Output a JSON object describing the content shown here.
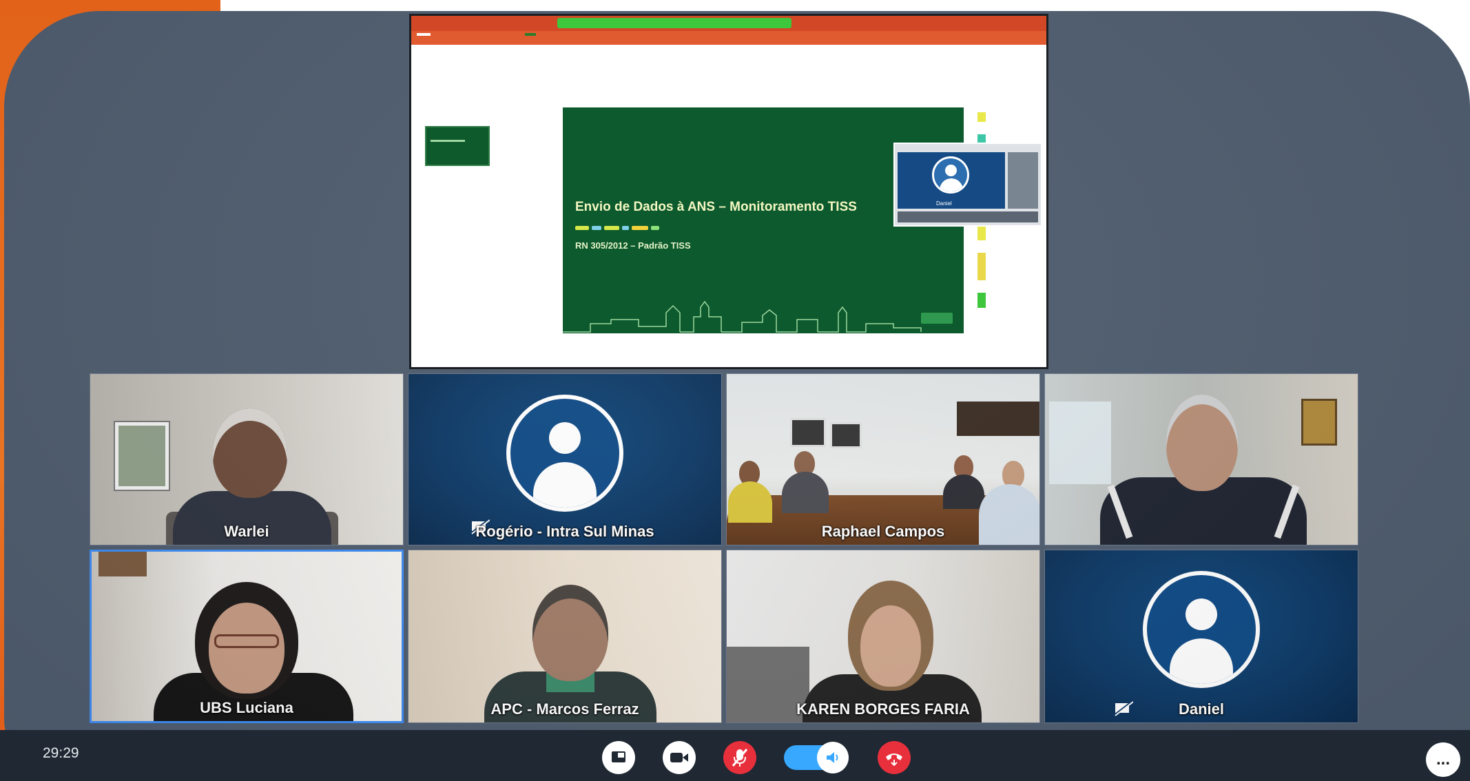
{
  "meeting": {
    "timer": "29:29"
  },
  "shared_screen": {
    "slide_title": "Envio de Dados à ANS – Monitoramento TISS",
    "slide_subtitle": "RN 305/2012 – Padrão TISS",
    "mini_video_label": "Daniel",
    "title_bar_color": "#d24726",
    "slide_color": "#0c5a2d"
  },
  "participants": [
    {
      "name": "Warlei",
      "video": true
    },
    {
      "name": "Rogério - Intra Sul Minas",
      "video": false,
      "muted": true
    },
    {
      "name": "Raphael Campos",
      "video": true
    },
    {
      "name": "",
      "video": true
    },
    {
      "name": "UBS Luciana",
      "video": true,
      "active_speaker": true
    },
    {
      "name": "APC - Marcos Ferraz",
      "video": true
    },
    {
      "name": "KAREN BORGES FARIA",
      "video": true
    },
    {
      "name": "Daniel",
      "video": false,
      "muted": true
    }
  ],
  "toolbar": {
    "buttons": [
      {
        "icon": "share-screen-icon",
        "color": "#ffffff"
      },
      {
        "icon": "camera-icon",
        "color": "#ffffff"
      },
      {
        "icon": "mic-off-icon",
        "color": "#e8303c"
      },
      {
        "icon": "speaker-toggle-icon",
        "color": "#38a8ff"
      },
      {
        "icon": "hang-up-icon",
        "color": "#e8303c"
      }
    ],
    "more_icon": "more-options-icon",
    "more_label": "..."
  }
}
